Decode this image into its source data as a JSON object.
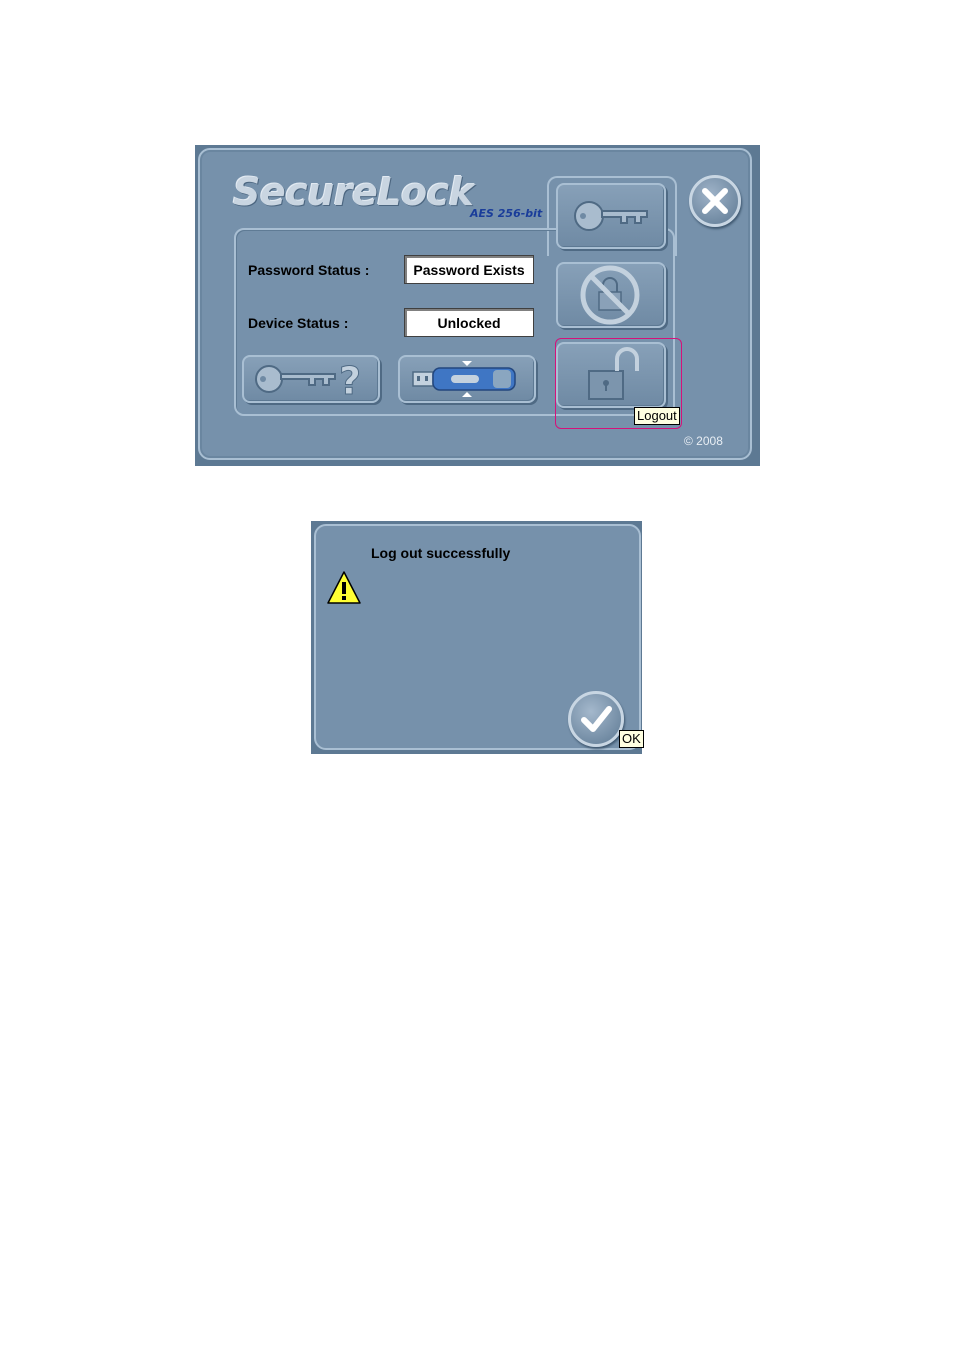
{
  "app": {
    "logo": "SecureLock",
    "logo_sub": "AES 256-bit",
    "password_status_label": "Password Status :",
    "password_status_value": "Password Exists",
    "device_status_label": "Device Status :",
    "device_status_value": "Unlocked",
    "copyright": "© 2008",
    "icons": {
      "close": "close-icon",
      "change_password": "key-icon",
      "lock": "no-lock-icon",
      "logout": "unlock-icon",
      "password_hint": "key-question-icon",
      "device": "usb-drive-icon"
    },
    "tooltip": "Logout",
    "colors": {
      "window_bg": "#7691ab",
      "highlight": "#d4127a",
      "logo_sub": "#1a3d9a"
    }
  },
  "dialog": {
    "message": "Log out successfully",
    "ok_tooltip": "OK",
    "icons": {
      "warning": "warning-icon",
      "ok": "checkmark-icon"
    }
  }
}
